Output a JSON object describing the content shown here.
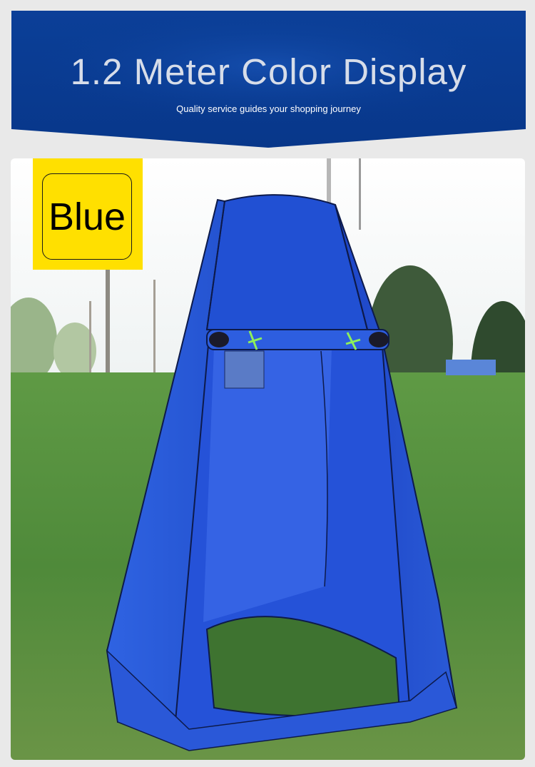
{
  "header": {
    "title": "1.2 Meter Color Display",
    "subtitle": "Quality service guides your shopping journey"
  },
  "product": {
    "color_label": "Blue",
    "image": "blue pop-up privacy shower tent standing on grass with trees in background"
  },
  "colors": {
    "banner": "#0a3d96",
    "tag": "#ffe000",
    "tent": "#1f4fd6"
  }
}
